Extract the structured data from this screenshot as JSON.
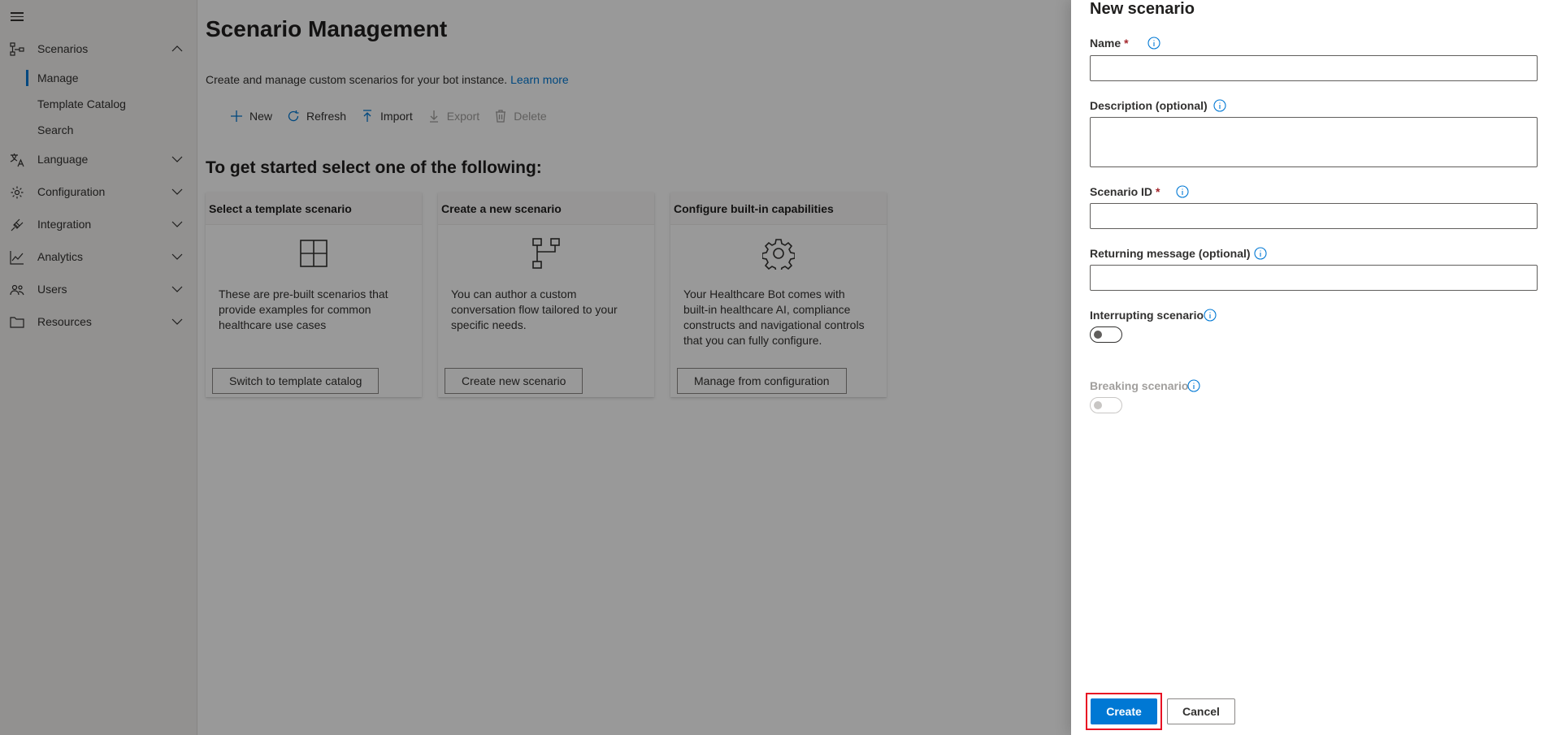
{
  "sidebar": {
    "menu_icon": "hamburger-menu-icon",
    "items": [
      {
        "label": "Scenarios",
        "icon": "flow-chart-icon",
        "expanded": true
      },
      {
        "label": "Language",
        "icon": "language-icon",
        "expanded": false
      },
      {
        "label": "Configuration",
        "icon": "gear-icon",
        "expanded": false
      },
      {
        "label": "Integration",
        "icon": "plug-icon",
        "expanded": false
      },
      {
        "label": "Analytics",
        "icon": "chart-icon",
        "expanded": false
      },
      {
        "label": "Users",
        "icon": "users-icon",
        "expanded": false
      },
      {
        "label": "Resources",
        "icon": "folder-icon",
        "expanded": false
      }
    ],
    "sub_items": [
      {
        "label": "Manage",
        "selected": true
      },
      {
        "label": "Template Catalog",
        "selected": false
      },
      {
        "label": "Search",
        "selected": false
      }
    ]
  },
  "main": {
    "title": "Scenario Management",
    "description": "Create and manage custom scenarios for your bot instance.",
    "learn_more": "Learn more",
    "toolbar": {
      "new": "New",
      "refresh": "Refresh",
      "import": "Import",
      "export": "Export",
      "delete": "Delete"
    },
    "section_heading": "To get started select one of the following:",
    "cards": [
      {
        "title": "Select a template scenario",
        "icon": "grid-icon",
        "text": "These are pre-built scenarios that provide examples for common healthcare use cases",
        "button": "Switch to template catalog"
      },
      {
        "title": "Create a new scenario",
        "icon": "flow-icon",
        "text": "You can author a custom conversation flow tailored to your specific needs.",
        "button": "Create new scenario"
      },
      {
        "title": "Configure built-in capabilities",
        "icon": "gear-icon",
        "text": "Your Healthcare Bot comes with built-in healthcare AI, compliance constructs and navigational controls that you can fully configure.",
        "button": "Manage from configuration"
      }
    ]
  },
  "panel": {
    "title": "New scenario",
    "fields": {
      "name_label": "Name",
      "name_value": "",
      "description_label": "Description (optional)",
      "description_value": "",
      "scenario_id_label": "Scenario ID",
      "scenario_id_value": "",
      "returning_message_label": "Returning message (optional)",
      "returning_message_value": "",
      "interrupting_label": "Interrupting scenario",
      "interrupting_on": false,
      "breaking_label": "Breaking scenario",
      "breaking_on": false,
      "required_marker": "*"
    },
    "buttons": {
      "create": "Create",
      "cancel": "Cancel"
    }
  },
  "colors": {
    "accent": "#0078d4",
    "highlight_box": "#e81123",
    "required": "#a4262c"
  }
}
